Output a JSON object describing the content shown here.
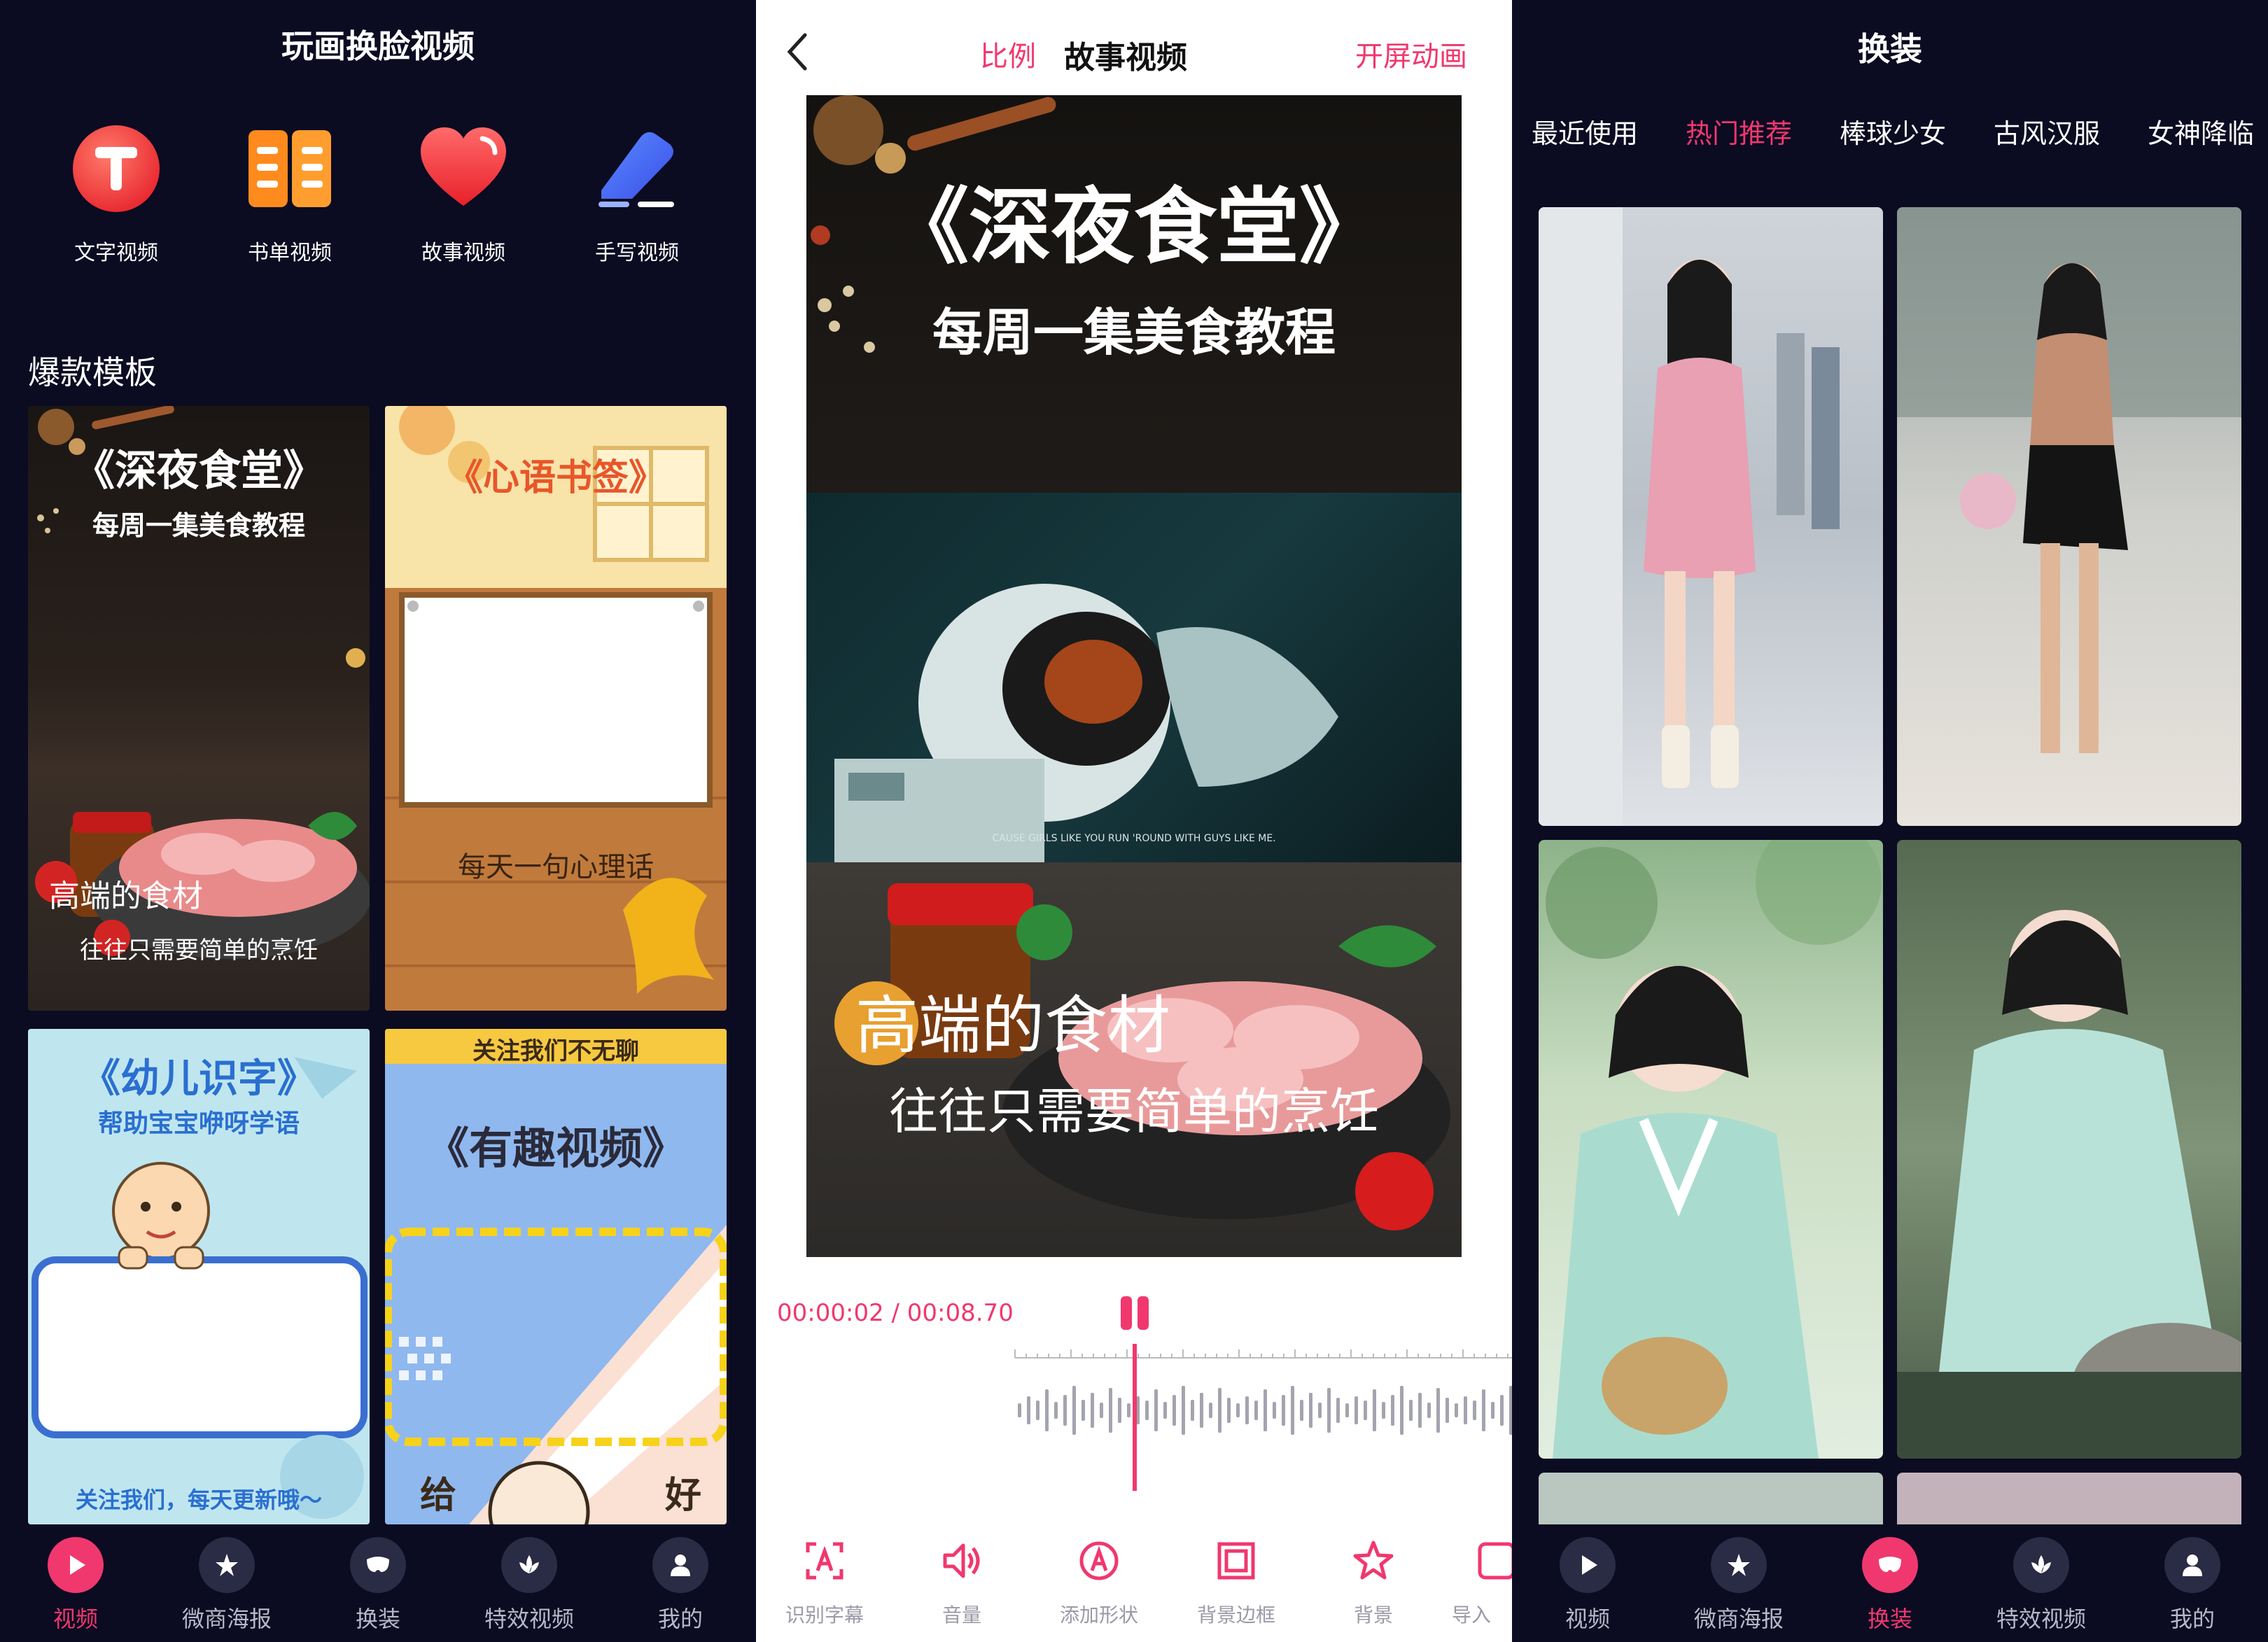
{
  "panel1": {
    "title": "玩画换脸视频",
    "tools": [
      {
        "label": "文字视频",
        "icon": "text-t-icon"
      },
      {
        "label": "书单视频",
        "icon": "book-list-icon"
      },
      {
        "label": "故事视频",
        "icon": "heart-icon"
      },
      {
        "label": "手写视频",
        "icon": "handwriting-pen-icon"
      }
    ],
    "section_title": "爆款模板",
    "templates": [
      {
        "title": "《深夜食堂》",
        "subtitle": "每周一集美食教程",
        "line1": "高端的食材",
        "line2": "往往只需要简单的烹饪"
      },
      {
        "title": "《心语书签》",
        "line1": "每天一句心理话"
      },
      {
        "title": "《幼儿识字》",
        "subtitle": "帮助宝宝咿呀学语",
        "footer": "关注我们，每天更新哦～"
      },
      {
        "top": "关注我们不无聊",
        "title": "《有趣视频》",
        "bottom_left": "给",
        "bottom_right": "好"
      }
    ]
  },
  "tabbar": {
    "items": [
      "视频",
      "微商海报",
      "换装",
      "特效视频",
      "我的"
    ]
  },
  "panel2": {
    "left_label": "比例",
    "title": "故事视频",
    "right_label": "开屏动画",
    "video": {
      "title": "《深夜食堂》",
      "subtitle": "每周一集美食教程",
      "caption_small": "CAUSE GIRLS LIKE YOU RUN 'ROUND WITH GUYS LIKE ME.",
      "line1": "高端的食材",
      "line2": "往往只需要简单的烹饪"
    },
    "timecode": "00:00:02 / 00:08.70",
    "tools": [
      {
        "label": "识别字幕",
        "icon": "caption-recognize-icon"
      },
      {
        "label": "音量",
        "icon": "volume-icon"
      },
      {
        "label": "添加形状",
        "icon": "add-shape-icon"
      },
      {
        "label": "背景边框",
        "icon": "background-border-icon"
      },
      {
        "label": "背景",
        "icon": "star-icon"
      },
      {
        "label": "导入",
        "icon": "import-icon"
      }
    ]
  },
  "panel3": {
    "title": "换装",
    "categories": [
      "最近使用",
      "热门推荐",
      "棒球少女",
      "古风汉服",
      "女神降临"
    ],
    "active_category": "热门推荐"
  },
  "colors": {
    "accent": "#f0386e",
    "dark_bg": "#0b0b22",
    "tab_icon_bg": "#2a2b44"
  }
}
